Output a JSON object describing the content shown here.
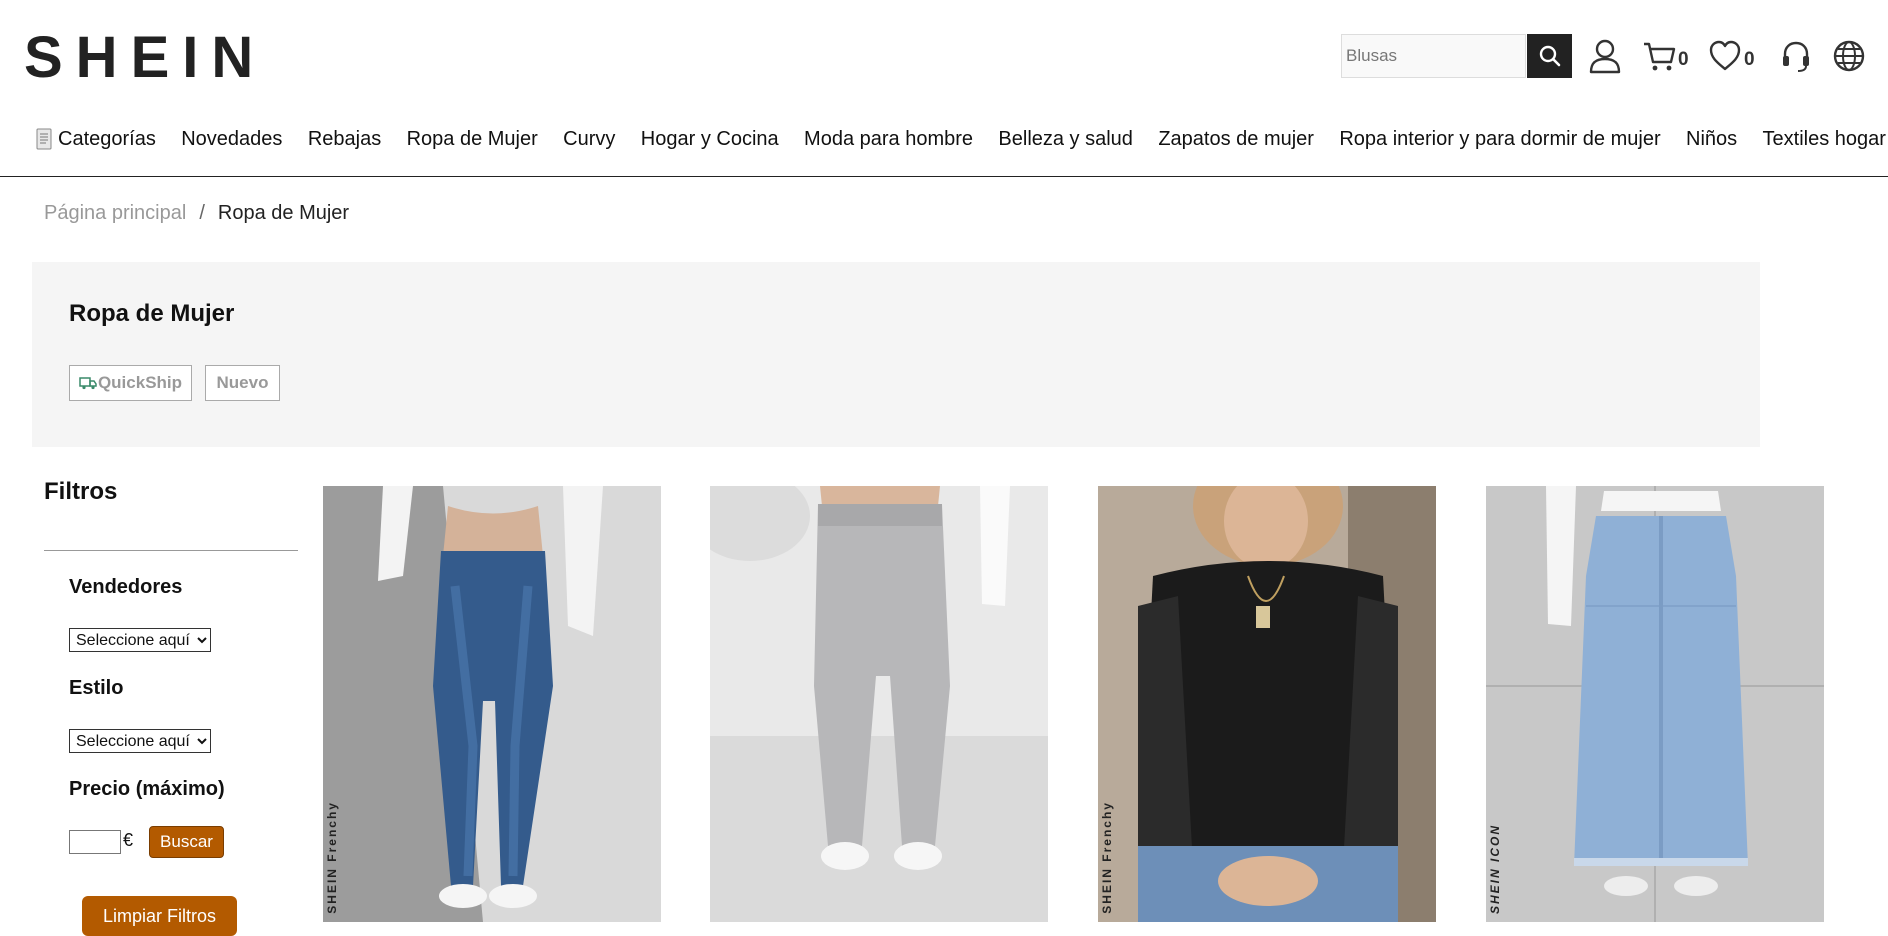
{
  "header": {
    "logo": "SHEIN",
    "search_placeholder": "Blusas",
    "cart_count": "0",
    "wishlist_count": "0"
  },
  "nav": [
    {
      "label": "Categorías"
    },
    {
      "label": "Novedades"
    },
    {
      "label": "Rebajas"
    },
    {
      "label": "Ropa de Mujer"
    },
    {
      "label": "Curvy"
    },
    {
      "label": "Hogar y Cocina"
    },
    {
      "label": "Moda para hombre"
    },
    {
      "label": "Belleza y salud"
    },
    {
      "label": "Zapatos de mujer"
    },
    {
      "label": "Ropa interior y para dormir de mujer"
    },
    {
      "label": "Niños"
    },
    {
      "label": "Textiles hogar"
    }
  ],
  "breadcrumb": {
    "home": "Página principal",
    "separator": "/",
    "current": "Ropa de Mujer"
  },
  "banner": {
    "title": "Ropa de Mujer",
    "tags": [
      "QuickShip",
      "Nuevo"
    ]
  },
  "filters": {
    "title": "Filtros",
    "sellers_label": "Vendedores",
    "sellers_select": "Seleccione aquí",
    "style_label": "Estilo",
    "style_select": "Seleccione aquí",
    "price_label": "Precio (máximo)",
    "currency": "€",
    "search_button": "Buscar",
    "clear_button": "Limpiar Filtros"
  },
  "products": [
    {
      "image": "flare-jeans-photo",
      "watermark": "SHEIN Frenchy"
    },
    {
      "image": "grey-joggers-photo",
      "watermark": ""
    },
    {
      "image": "black-lace-sweater-photo",
      "watermark": "SHEIN Frenchy"
    },
    {
      "image": "denim-maxi-skirt-photo",
      "watermark": "SHEIN ICON"
    }
  ],
  "colors": {
    "accent_button": "#b35a00",
    "search_button": "#222222",
    "banner_bg": "#f5f5f5"
  }
}
